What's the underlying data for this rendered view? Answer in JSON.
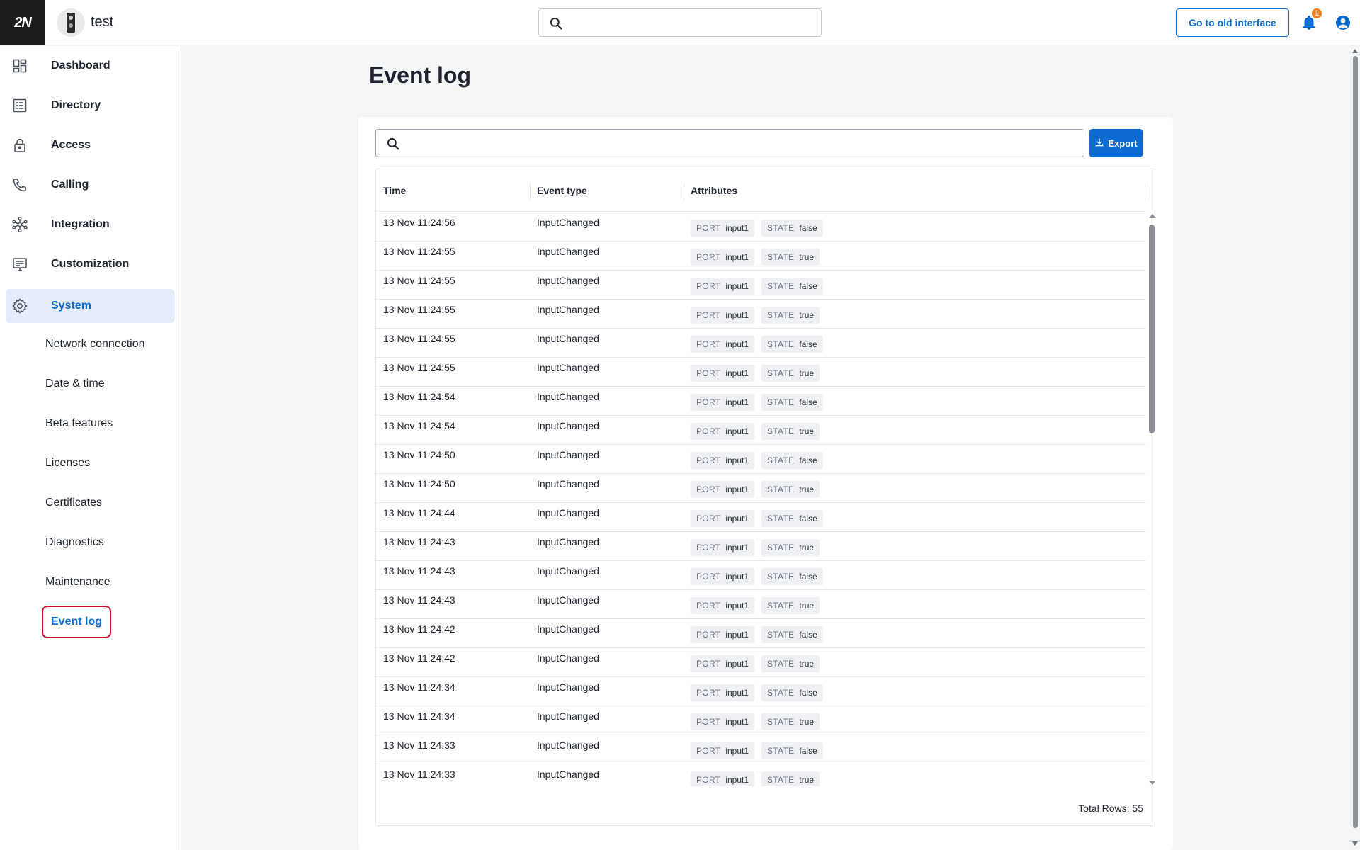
{
  "header": {
    "logo_text": "2N",
    "device_name": "test",
    "search_placeholder": "",
    "old_interface_label": "Go to old interface",
    "notification_count": "1"
  },
  "sidebar": {
    "items": [
      {
        "label": "Dashboard",
        "icon": "dashboard-icon"
      },
      {
        "label": "Directory",
        "icon": "directory-icon"
      },
      {
        "label": "Access",
        "icon": "lock-icon"
      },
      {
        "label": "Calling",
        "icon": "phone-icon"
      },
      {
        "label": "Integration",
        "icon": "integration-icon"
      },
      {
        "label": "Customization",
        "icon": "display-icon"
      },
      {
        "label": "System",
        "icon": "gear-icon",
        "active": true
      }
    ],
    "sub_items": [
      "Network connection",
      "Date & time",
      "Beta features",
      "Licenses",
      "Certificates",
      "Diagnostics",
      "Maintenance",
      "Event log"
    ],
    "current_sub_item": "Event log"
  },
  "main": {
    "title": "Event log",
    "search_placeholder": "",
    "export_label": "Export",
    "columns": [
      "Time",
      "Event type",
      "Attributes"
    ],
    "attribute_keys": {
      "port": "PORT",
      "state": "STATE"
    },
    "rows": [
      {
        "time": "13 Nov 11:24:56",
        "type": "InputChanged",
        "port": "input1",
        "state": "false"
      },
      {
        "time": "13 Nov 11:24:55",
        "type": "InputChanged",
        "port": "input1",
        "state": "true"
      },
      {
        "time": "13 Nov 11:24:55",
        "type": "InputChanged",
        "port": "input1",
        "state": "false"
      },
      {
        "time": "13 Nov 11:24:55",
        "type": "InputChanged",
        "port": "input1",
        "state": "true"
      },
      {
        "time": "13 Nov 11:24:55",
        "type": "InputChanged",
        "port": "input1",
        "state": "false"
      },
      {
        "time": "13 Nov 11:24:55",
        "type": "InputChanged",
        "port": "input1",
        "state": "true"
      },
      {
        "time": "13 Nov 11:24:54",
        "type": "InputChanged",
        "port": "input1",
        "state": "false"
      },
      {
        "time": "13 Nov 11:24:54",
        "type": "InputChanged",
        "port": "input1",
        "state": "true"
      },
      {
        "time": "13 Nov 11:24:50",
        "type": "InputChanged",
        "port": "input1",
        "state": "false"
      },
      {
        "time": "13 Nov 11:24:50",
        "type": "InputChanged",
        "port": "input1",
        "state": "true"
      },
      {
        "time": "13 Nov 11:24:44",
        "type": "InputChanged",
        "port": "input1",
        "state": "false"
      },
      {
        "time": "13 Nov 11:24:43",
        "type": "InputChanged",
        "port": "input1",
        "state": "true"
      },
      {
        "time": "13 Nov 11:24:43",
        "type": "InputChanged",
        "port": "input1",
        "state": "false"
      },
      {
        "time": "13 Nov 11:24:43",
        "type": "InputChanged",
        "port": "input1",
        "state": "true"
      },
      {
        "time": "13 Nov 11:24:42",
        "type": "InputChanged",
        "port": "input1",
        "state": "false"
      },
      {
        "time": "13 Nov 11:24:42",
        "type": "InputChanged",
        "port": "input1",
        "state": "true"
      },
      {
        "time": "13 Nov 11:24:34",
        "type": "InputChanged",
        "port": "input1",
        "state": "false"
      },
      {
        "time": "13 Nov 11:24:34",
        "type": "InputChanged",
        "port": "input1",
        "state": "true"
      },
      {
        "time": "13 Nov 11:24:33",
        "type": "InputChanged",
        "port": "input1",
        "state": "false"
      },
      {
        "time": "13 Nov 11:24:33",
        "type": "InputChanged",
        "port": "input1",
        "state": "true"
      }
    ],
    "total_rows_label": "Total Rows: 55"
  },
  "colors": {
    "accent": "#0b6bd1",
    "active_nav_bg": "#e4ebfa",
    "highlight_outline": "#c8102e",
    "badge": "#f07e1a"
  }
}
